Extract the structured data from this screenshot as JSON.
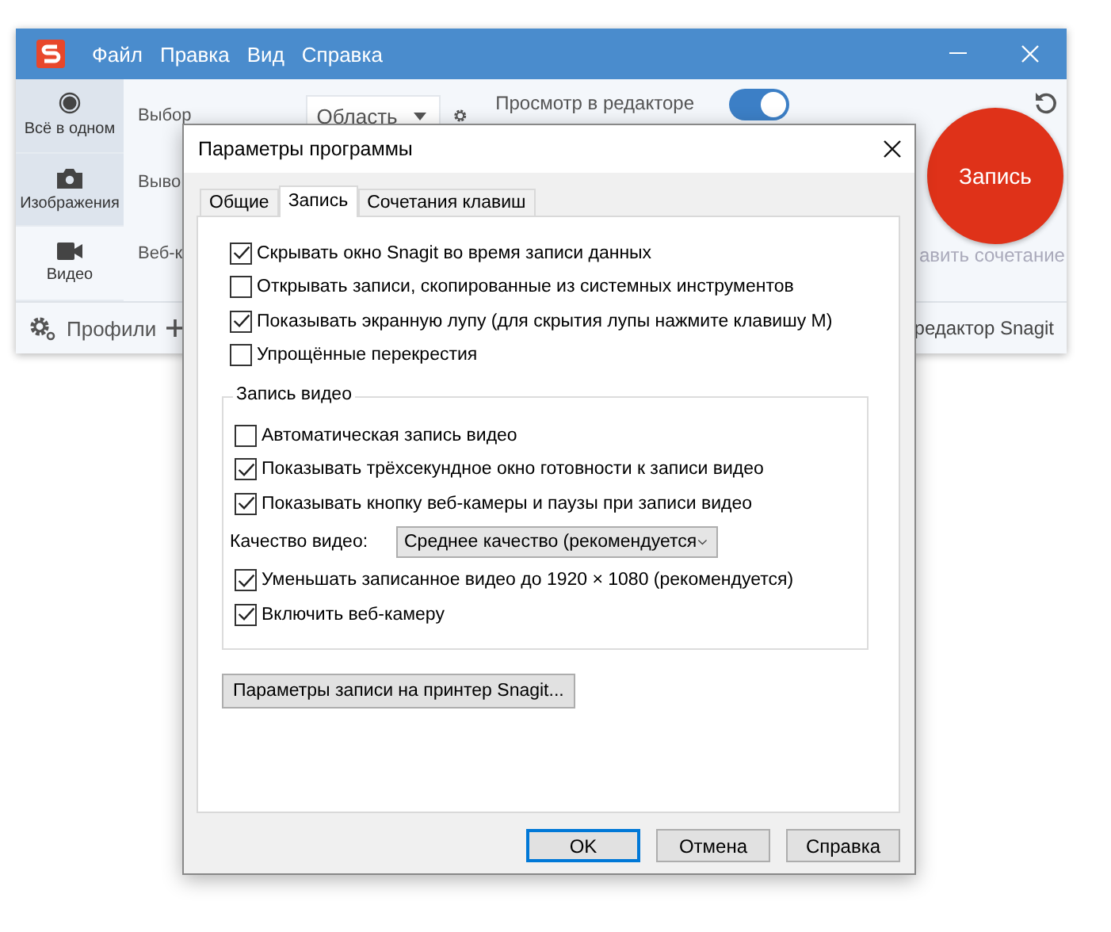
{
  "app": {
    "menu": [
      "Файл",
      "Правка",
      "Вид",
      "Справка"
    ],
    "modes": [
      {
        "kind": "all",
        "label": "Всё в одном",
        "selected": true
      },
      {
        "kind": "image",
        "label": "Изображения",
        "selected": true
      },
      {
        "kind": "video",
        "label": "Видео",
        "selected": false
      }
    ],
    "capture_labels": [
      "Выбор",
      "Выво",
      "Веб-к"
    ],
    "selection_value": "Область",
    "preview_label": "Просмотр в редакторе",
    "preview_on": true,
    "record_button": "Запись",
    "shortcut_hint": "авить сочетание",
    "profiles": "Профили",
    "editor_link": "редактор Snagit"
  },
  "dialog": {
    "title": "Параметры программы",
    "tabs": [
      {
        "label": "Общие",
        "selected": false
      },
      {
        "label": "Запись",
        "selected": true
      },
      {
        "label": "Сочетания клавиш",
        "selected": false
      }
    ],
    "options": [
      {
        "label": "Скрывать окно Snagit во время записи данных",
        "checked": true
      },
      {
        "label": "Открывать записи, скопированные из системных инструментов",
        "checked": false
      },
      {
        "label": "Показывать экранную лупу (для скрытия лупы нажмите клавишу M)",
        "checked": true
      },
      {
        "label": "Упрощённые перекрестия",
        "checked": false
      }
    ],
    "video_group": {
      "legend": "Запись видео",
      "options_before": [
        {
          "label": "Автоматическая запись видео",
          "checked": false
        },
        {
          "label": "Показывать трёхсекундное окно готовности к записи видео",
          "checked": true
        },
        {
          "label": "Показывать кнопку веб-камеры и паузы при записи видео",
          "checked": true
        }
      ],
      "quality": {
        "label": "Качество видео:",
        "value": "Среднее качество (рекомендуется"
      },
      "options_after": [
        {
          "label": "Уменьшать записанное видео до 1920 × 1080 (рекомендуется)",
          "checked": true
        },
        {
          "label": "Включить веб-камеру",
          "checked": true
        }
      ]
    },
    "printer_button": "Параметры записи на принтер Snagit...",
    "buttons": [
      {
        "label": "OK",
        "focused": true
      },
      {
        "label": "Отмена",
        "focused": false
      },
      {
        "label": "Справка",
        "focused": false
      }
    ]
  }
}
